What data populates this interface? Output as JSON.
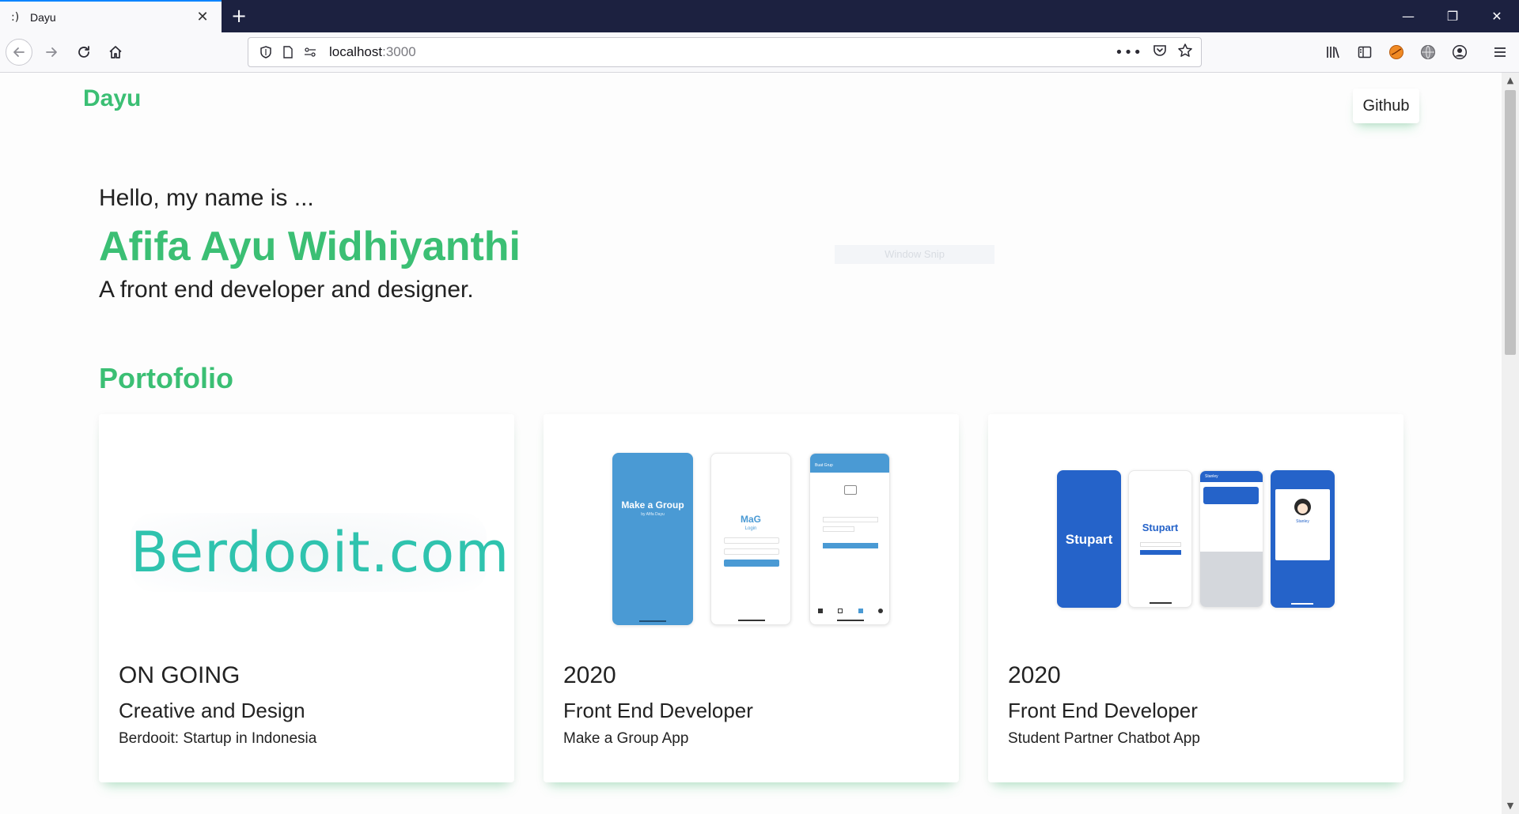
{
  "browser": {
    "tab_favicon": ":)",
    "tab_title": "Dayu",
    "url_host": "localhost",
    "url_port": ":3000"
  },
  "site": {
    "logo": "Dayu",
    "github_label": "Github"
  },
  "hero": {
    "greeting": "Hello, my name is ...",
    "name": "Afifa Ayu Widhiyanthi",
    "tagline": "A front end developer and designer.",
    "ghost_text": "Window Snip"
  },
  "portfolio": {
    "title": "Portofolio",
    "cards": [
      {
        "year": "ON GOING",
        "role": "Creative and Design",
        "desc": "Berdooit: Startup in Indonesia",
        "logo_text": "Berdooit.com"
      },
      {
        "year": "2020",
        "role": "Front End Developer",
        "desc": "Make a Group App",
        "screen1_title": "Make a Group",
        "screen1_sub": "by Afifa Dayu",
        "screen2_title": "MaG",
        "screen2_sub": "Login",
        "screen3_title": "Buat Grup"
      },
      {
        "year": "2020",
        "role": "Front End Developer",
        "desc": "Student Partner Chatbot App",
        "screen1_title": "Stupart",
        "screen2_title": "Stupart",
        "screen3_title": "Stanley",
        "screen4_title": "Stanley"
      }
    ]
  },
  "colors": {
    "accent": "#3bbf74",
    "teal": "#2fc3ae",
    "chrome_dark": "#1c2140",
    "mag_blue": "#4a9ad4",
    "stupart_blue": "#2563c9"
  }
}
